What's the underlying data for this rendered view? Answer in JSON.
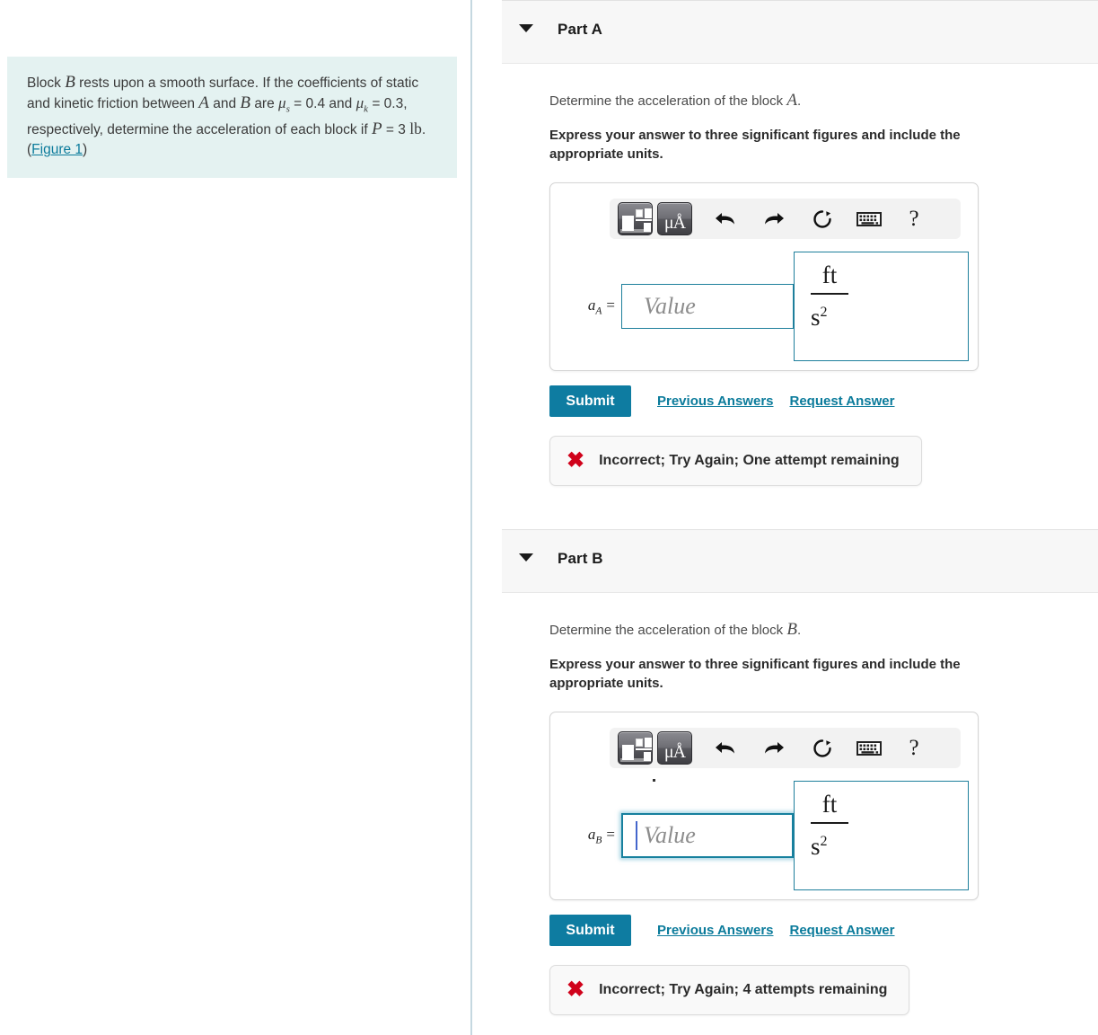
{
  "problem": {
    "text_lead": "Block",
    "var_b1": "B",
    "text_2": "rests upon a smooth surface. If the coefficients of static and kinetic friction between",
    "var_a1": "A",
    "text_and": "and",
    "var_b2": "B",
    "text_are": "are",
    "mu_s": "μ",
    "mu_s_sub": "s",
    "mu_s_value": "= 0.4",
    "text_and2": "and",
    "mu_k": "μ",
    "mu_k_sub": "k",
    "mu_k_value": "= 0.3, respectively, determine the acceleration of each block if",
    "var_p": "P",
    "p_value": "= 3",
    "p_units": "lb",
    "paren_open": ". (",
    "figure_link": "Figure 1",
    "paren_close": ")"
  },
  "toolbar": {
    "template_icon": "math-template-icon",
    "units_icon": "μÅ",
    "undo_icon": "undo-arrow-icon",
    "redo_icon": "redo-arrow-icon",
    "reset_icon": "reset-circular-arrow-icon",
    "keyboard_icon": "keyboard-icon",
    "help_label": "?"
  },
  "parts": [
    {
      "id": "part-a",
      "title": "Part A",
      "question_prefix": "Determine the acceleration of the block",
      "question_var": "A",
      "question_suffix": ".",
      "instruction": "Express your answer to three significant figures and include the appropriate units.",
      "answer": {
        "label_var": "a",
        "label_sub": "A",
        "label_equals": "=",
        "value": "",
        "placeholder": "Value",
        "focused": false,
        "unit_numerator": "ft",
        "unit_denominator": "s",
        "unit_denominator_exp": "2"
      },
      "submit_label": "Submit",
      "previous_answers_label": "Previous Answers",
      "request_answer_label": "Request Answer",
      "feedback": {
        "icon": "red-x-icon",
        "icon_glyph": "✖",
        "text": "Incorrect; Try Again; One attempt remaining"
      }
    },
    {
      "id": "part-b",
      "title": "Part B",
      "question_prefix": "Determine the acceleration of the block",
      "question_var": "B",
      "question_suffix": ".",
      "instruction": "Express your answer to three significant figures and include the appropriate units.",
      "answer": {
        "label_var": "a",
        "label_sub": "B",
        "label_equals": "=",
        "value": "",
        "placeholder": "Value",
        "focused": true,
        "unit_numerator": "ft",
        "unit_denominator": "s",
        "unit_denominator_exp": "2"
      },
      "submit_label": "Submit",
      "previous_answers_label": "Previous Answers",
      "request_answer_label": "Request Answer",
      "feedback": {
        "icon": "red-x-icon",
        "icon_glyph": "✖",
        "text": "Incorrect; Try Again; 4 attempts remaining"
      }
    }
  ],
  "colors": {
    "accent_teal": "#0e7ca1",
    "link_teal": "#0b7b9b",
    "problem_bg": "#e4f2f1",
    "error_red": "#d0021b",
    "header_bg": "#f7f7f7"
  }
}
